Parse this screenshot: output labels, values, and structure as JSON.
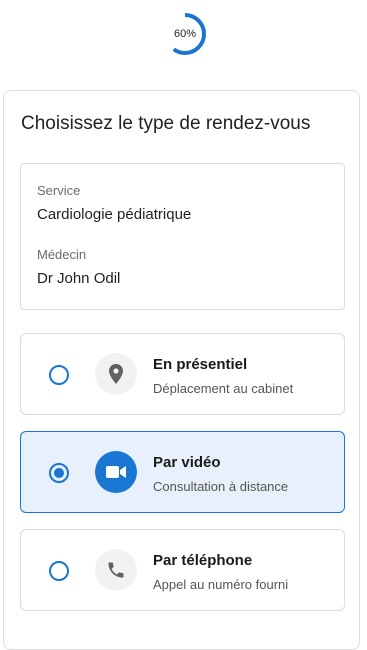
{
  "progress": {
    "label": "60%",
    "value": 0.6,
    "color": "#1976d2"
  },
  "page": {
    "title": "Choisissez le type de rendez-vous"
  },
  "summary": {
    "service_label": "Service",
    "service_value": "Cardiologie pédiatrique",
    "doctor_label": "Médecin",
    "doctor_value": "Dr John Odil"
  },
  "options": [
    {
      "title": "En présentiel",
      "subtitle": "Déplacement au cabinet",
      "icon": "location-pin-icon",
      "selected": false
    },
    {
      "title": "Par vidéo",
      "subtitle": "Consultation à distance",
      "icon": "video-camera-icon",
      "selected": true
    },
    {
      "title": "Par téléphone",
      "subtitle": "Appel au numéro fourni",
      "icon": "phone-icon",
      "selected": false
    }
  ],
  "colors": {
    "accent": "#1976d2",
    "selected_bg": "#e8f1fb",
    "border": "#dcdcdc"
  }
}
